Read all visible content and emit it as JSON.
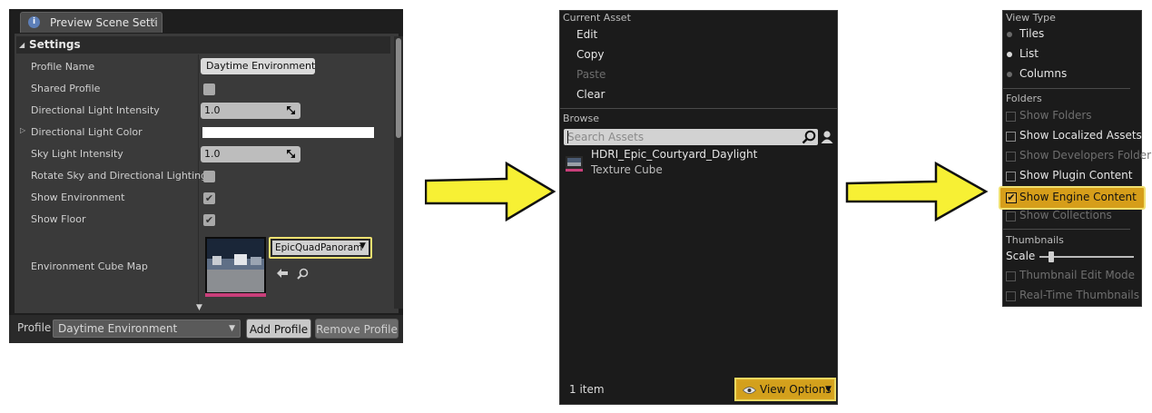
{
  "panel1": {
    "tab_title": "Preview Scene Setti",
    "tab_close": "×",
    "section_title": "Settings",
    "properties": {
      "profile_name": {
        "label": "Profile Name",
        "value": "Daytime Environment"
      },
      "shared_profile": {
        "label": "Shared Profile",
        "checked": false
      },
      "dir_light_intensity": {
        "label": "Directional Light Intensity",
        "value": "1.0"
      },
      "dir_light_color": {
        "label": "Directional Light Color",
        "color": "#ffffff"
      },
      "sky_light_intensity": {
        "label": "Sky Light Intensity",
        "value": "1.0"
      },
      "rotate_sky": {
        "label": "Rotate Sky and Directional Lighting",
        "checked": false
      },
      "show_environment": {
        "label": "Show Environment",
        "checked": true
      },
      "show_floor": {
        "label": "Show Floor",
        "checked": true
      },
      "env_cube_map": {
        "label": "Environment Cube Map",
        "asset": "EpicQuadPanoram"
      }
    },
    "footer": {
      "profile_label": "Profile",
      "profile_select": "Daytime Environment",
      "add_profile": "Add Profile",
      "remove_profile": "Remove Profile"
    }
  },
  "panel2": {
    "current_asset_header": "Current Asset",
    "menu": [
      "Edit",
      "Copy",
      "Paste",
      "Clear"
    ],
    "browse_header": "Browse",
    "search_placeholder": "Search Assets",
    "asset": {
      "name": "HDRI_Epic_Courtyard_Daylight",
      "type": "Texture Cube"
    },
    "status": "1 item",
    "view_options": "View Options"
  },
  "panel3": {
    "view_type_header": "View Type",
    "view_types": [
      "Tiles",
      "List",
      "Columns"
    ],
    "selected_view_type": "List",
    "folders_header": "Folders",
    "folder_options": [
      {
        "label": "Show Folders",
        "enabled": false,
        "checked": false
      },
      {
        "label": "Show Localized Assets",
        "enabled": true,
        "checked": false
      },
      {
        "label": "Show Developers Folder",
        "enabled": false,
        "checked": false
      },
      {
        "label": "Show Plugin Content",
        "enabled": true,
        "checked": false
      },
      {
        "label": "Show Engine Content",
        "enabled": true,
        "checked": true
      },
      {
        "label": "Show Collections",
        "enabled": false,
        "checked": false
      }
    ],
    "thumbnails_header": "Thumbnails",
    "scale_label": "Scale",
    "scale_value": 0.12,
    "thumb_options": [
      {
        "label": "Thumbnail Edit Mode",
        "enabled": false
      },
      {
        "label": "Real-Time Thumbnails",
        "enabled": false
      }
    ]
  },
  "colors": {
    "highlight": "#d69e1a",
    "highlight_border": "#f0e070",
    "arrow": "#f7f034",
    "panel_bg": "#1b1b1b",
    "asset_color_bar": "#c93f7a"
  },
  "icons": [
    "info-icon",
    "search-icon",
    "user-icon",
    "eye-icon",
    "dropdown-arrow-icon",
    "use-selected-arrow-icon",
    "browse-search-icon",
    "drag-icon"
  ]
}
